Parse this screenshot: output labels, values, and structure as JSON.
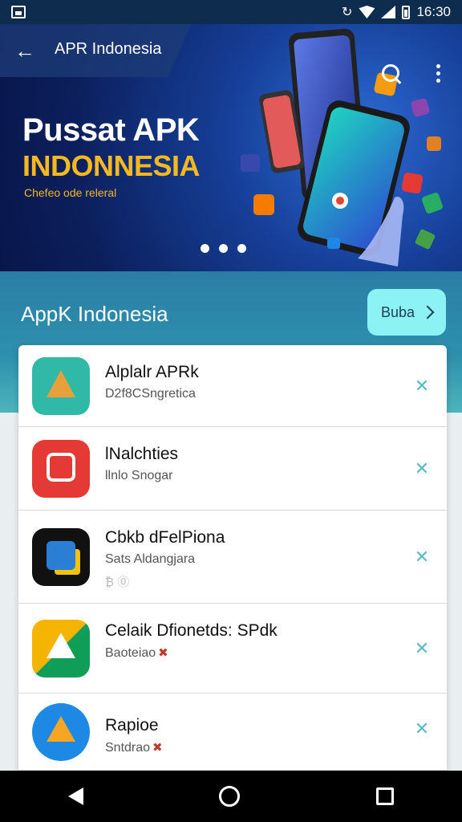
{
  "status": {
    "time": "16:30"
  },
  "app_bar": {
    "title": "APR Indonesia"
  },
  "banner": {
    "title": "Pussat APK",
    "subtitle": "INDONNESIA",
    "caption": "Chefeo ode releral",
    "slides": 3
  },
  "section": {
    "title": "AppK Indonesia",
    "button_label": "Buba"
  },
  "apps": [
    {
      "name": "Alplalr APRk",
      "meta": "D2f8CSngretica",
      "meta2": "",
      "badge": false,
      "icon_colors": [
        "#2fb9a6",
        "#e8a13a",
        "#d9483b"
      ]
    },
    {
      "name": "lNalchties",
      "meta": "llnlo Snogar",
      "meta2": "",
      "badge": false,
      "icon_colors": [
        "#e53935",
        "#ffffff",
        "#c62828"
      ]
    },
    {
      "name": "Cbkb dFelPiona",
      "meta": "Sats Aldangjara",
      "meta2": "₿ ⓪",
      "badge": false,
      "icon_colors": [
        "#111111",
        "#2a7fd4",
        "#f4c20d"
      ]
    },
    {
      "name": "Celaik Dfionetds: SPdk",
      "meta": "Baoteiao",
      "meta2": "",
      "badge": true,
      "icon_colors": [
        "#f4b400",
        "#0f9d58",
        "#ffffff"
      ]
    },
    {
      "name": "Rapioe",
      "meta": "Sntdrao",
      "meta2": "",
      "badge": true,
      "icon_colors": [
        "#1e88e5",
        "#f6a623",
        "#ffffff"
      ]
    }
  ]
}
